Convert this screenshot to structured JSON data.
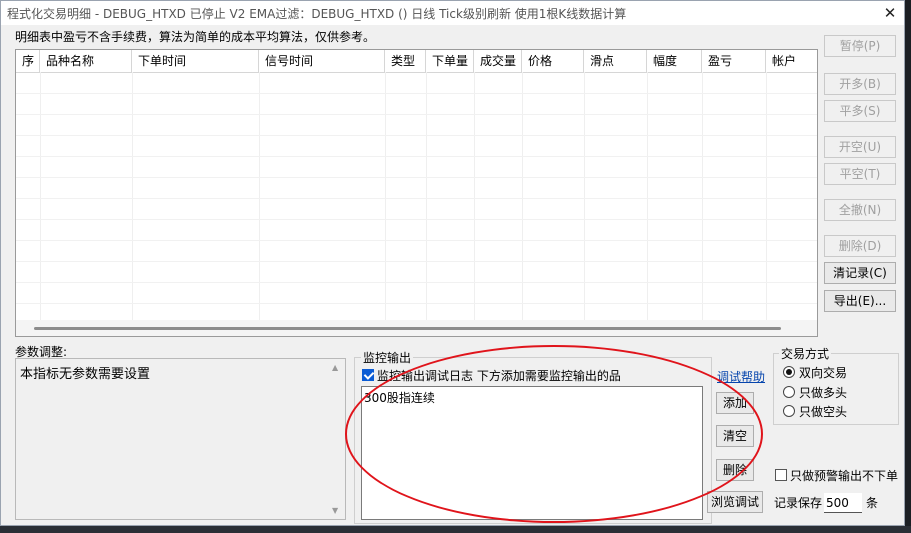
{
  "window": {
    "title": "程式化交易明细 - DEBUG_HTXD 已停止  V2 EMA过滤：DEBUG_HTXD () 日线 Tick级别刷新 使用1根K线数据计算",
    "close_label": "✕"
  },
  "note": "明细表中盈亏不含手续费，算法为简单的成本平均算法，仅供参考。",
  "table": {
    "columns": [
      "序",
      "品种名称",
      "下单时间",
      "信号时间",
      "类型",
      "下单量",
      "成交量",
      "价格",
      "滑点",
      "幅度",
      "盈亏",
      "帐户"
    ],
    "rows": []
  },
  "right_buttons": [
    {
      "label": "暂停(P)",
      "enabled": false
    },
    {
      "label": "开多(B)",
      "enabled": false
    },
    {
      "label": "平多(S)",
      "enabled": false
    },
    {
      "label": "开空(U)",
      "enabled": false
    },
    {
      "label": "平空(T)",
      "enabled": false
    },
    {
      "label": "全撤(N)",
      "enabled": false
    },
    {
      "label": "删除(D)",
      "enabled": false
    },
    {
      "label": "清记录(C)",
      "enabled": true
    },
    {
      "label": "导出(E)...",
      "enabled": true
    }
  ],
  "params": {
    "label": "参数调整:",
    "text": "本指标无参数需要设置"
  },
  "monitor": {
    "label": "监控输出",
    "checkbox_label": "监控输出调试日志 下方添加需要监控输出的品",
    "checked": true,
    "help_link": "调试帮助",
    "items": [
      "300股指连续"
    ],
    "add_button": "添加",
    "clear_button": "清空",
    "delete_button": "删除",
    "browse_button": "浏览调试"
  },
  "trade_mode": {
    "label": "交易方式",
    "options": [
      "双向交易",
      "只做多头",
      "只做空头"
    ],
    "selected": 0
  },
  "alert_only": {
    "label": "只做预警输出不下单",
    "checked": false
  },
  "record_keep": {
    "label": "记录保存",
    "value": "500",
    "unit": "条"
  }
}
